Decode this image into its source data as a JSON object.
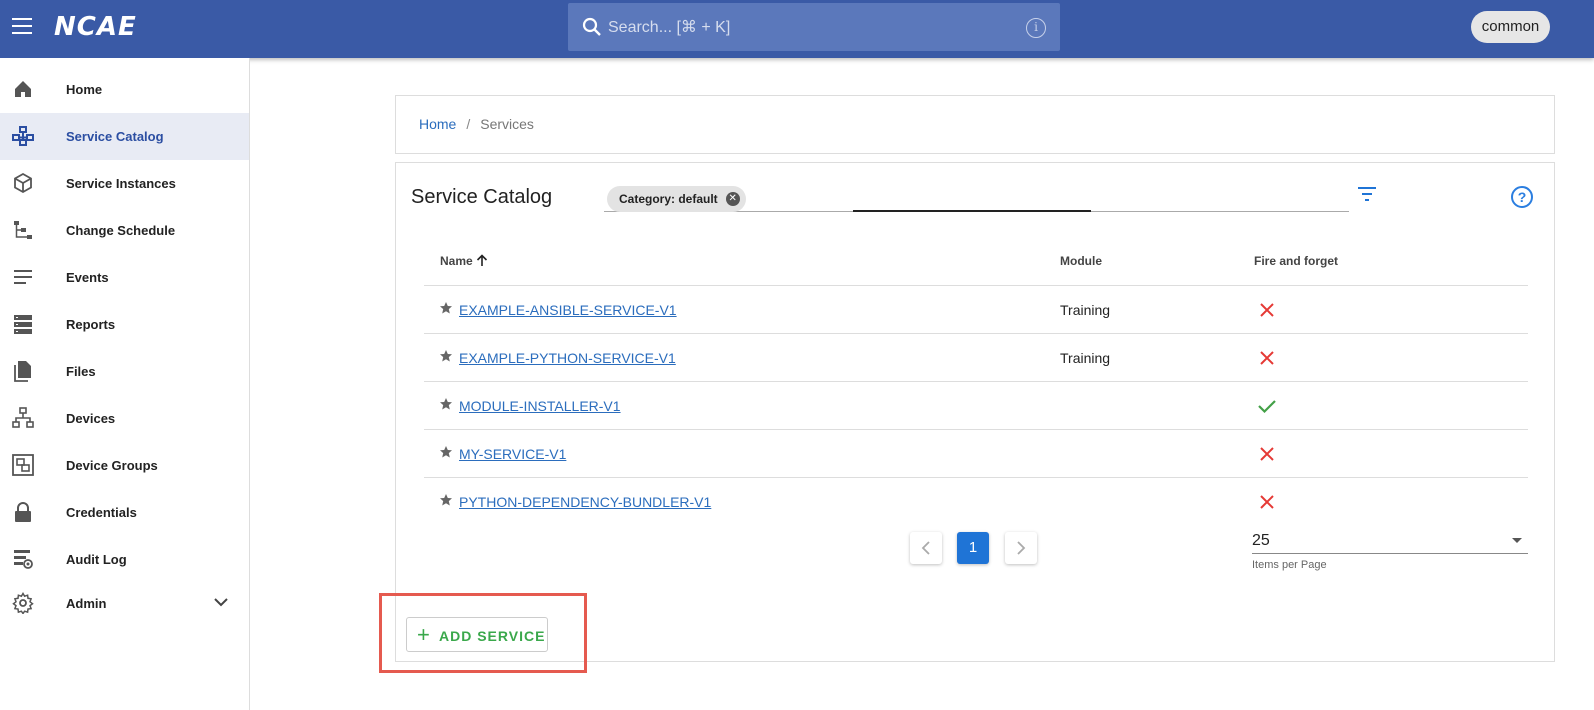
{
  "app": {
    "logo_text": "NCAE",
    "search_placeholder": "Search... [⌘ + K]",
    "user": "common"
  },
  "sidebar": {
    "items": [
      {
        "label": "Home",
        "icon": "home-icon"
      },
      {
        "label": "Service Catalog",
        "icon": "service-catalog-icon",
        "active": true
      },
      {
        "label": "Service Instances",
        "icon": "cube-icon"
      },
      {
        "label": "Change Schedule",
        "icon": "schedule-tree-icon"
      },
      {
        "label": "Events",
        "icon": "events-lines-icon"
      },
      {
        "label": "Reports",
        "icon": "reports-icon"
      },
      {
        "label": "Files",
        "icon": "files-icon"
      },
      {
        "label": "Devices",
        "icon": "devices-network-icon"
      },
      {
        "label": "Device Groups",
        "icon": "device-groups-icon"
      },
      {
        "label": "Credentials",
        "icon": "lock-icon"
      },
      {
        "label": "Audit Log",
        "icon": "audit-log-icon"
      },
      {
        "label": "Admin",
        "icon": "gear-icon"
      }
    ]
  },
  "breadcrumb": {
    "home": "Home",
    "separator": "/",
    "current": "Services"
  },
  "catalog": {
    "title": "Service Catalog",
    "filter_chip": "Category: default",
    "columns": {
      "name": "Name",
      "module": "Module",
      "fire_and_forget": "Fire and forget"
    },
    "rows": [
      {
        "name": "EXAMPLE-ANSIBLE-SERVICE-V1",
        "module": "Training",
        "fire_and_forget": false
      },
      {
        "name": "EXAMPLE-PYTHON-SERVICE-V1",
        "module": "Training",
        "fire_and_forget": false
      },
      {
        "name": "MODULE-INSTALLER-V1",
        "module": "",
        "fire_and_forget": true
      },
      {
        "name": "MY-SERVICE-V1",
        "module": "",
        "fire_and_forget": false
      },
      {
        "name": "PYTHON-DEPENDENCY-BUNDLER-V1",
        "module": "",
        "fire_and_forget": false
      }
    ],
    "pagination": {
      "current_page": "1",
      "items_per_page": "25",
      "items_per_page_label": "Items per Page"
    },
    "add_button": "ADD SERVICE"
  },
  "colors": {
    "topbar": "#3a5aa6",
    "link": "#2b6dbd",
    "false_mark": "#e53935",
    "true_mark": "#43a047",
    "add_green": "#3aa84b",
    "highlight": "#e55a4f"
  }
}
